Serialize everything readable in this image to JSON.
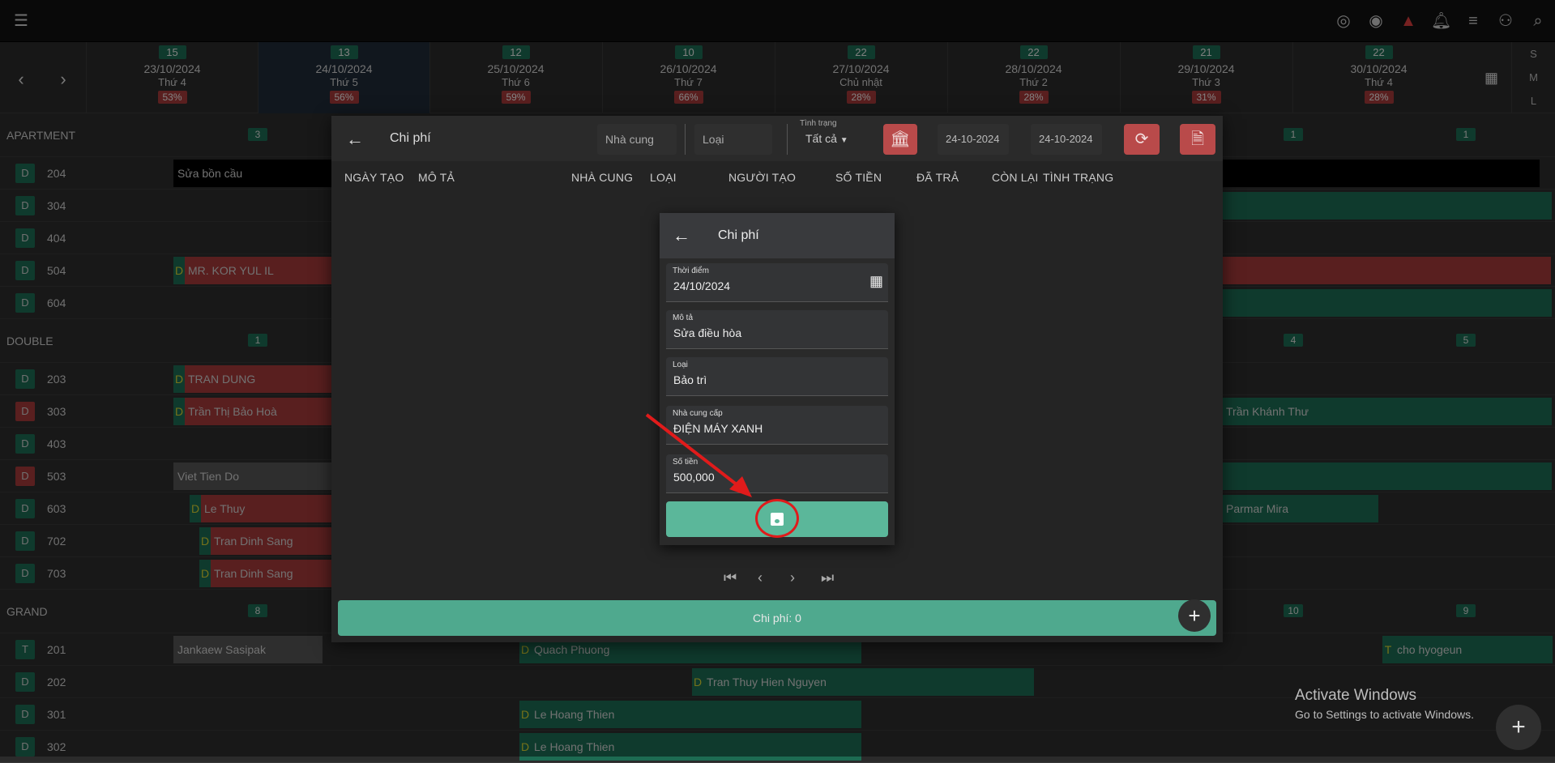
{
  "dates": [
    {
      "count": "15",
      "date": "23/10/2024",
      "weekday": "Thứ 4",
      "pct": "53%"
    },
    {
      "count": "13",
      "date": "24/10/2024",
      "weekday": "Thứ 5",
      "pct": "56%"
    },
    {
      "count": "12",
      "date": "25/10/2024",
      "weekday": "Thứ 6",
      "pct": "59%"
    },
    {
      "count": "10",
      "date": "26/10/2024",
      "weekday": "Thứ 7",
      "pct": "66%"
    },
    {
      "count": "22",
      "date": "27/10/2024",
      "weekday": "Chủ nhật",
      "pct": "28%"
    },
    {
      "count": "22",
      "date": "28/10/2024",
      "weekday": "Thứ 2",
      "pct": "28%"
    },
    {
      "count": "21",
      "date": "29/10/2024",
      "weekday": "Thứ 3",
      "pct": "31%"
    },
    {
      "count": "22",
      "date": "30/10/2024",
      "weekday": "Thứ 4",
      "pct": "28%"
    }
  ],
  "sizes": [
    "S",
    "M",
    "L"
  ],
  "groups": {
    "apartment": {
      "label": "APARTMENT",
      "c1": "3",
      "c2": "1",
      "c3": "1"
    },
    "double": {
      "label": "DOUBLE",
      "c1": "1",
      "c2": "4",
      "c3": "5"
    },
    "grand": {
      "label": "GRAND",
      "c1": "8",
      "c2": "10",
      "c3": "9"
    }
  },
  "rooms": [
    {
      "type": "D",
      "num": "204"
    },
    {
      "type": "D",
      "num": "304"
    },
    {
      "type": "D",
      "num": "404"
    },
    {
      "type": "D",
      "num": "504"
    },
    {
      "type": "D",
      "num": "604"
    },
    {
      "type": "D",
      "num": "203"
    },
    {
      "type": "D",
      "num": "303"
    },
    {
      "type": "D",
      "num": "403"
    },
    {
      "type": "D",
      "num": "503"
    },
    {
      "type": "D",
      "num": "603"
    },
    {
      "type": "D",
      "num": "702"
    },
    {
      "type": "D",
      "num": "703"
    },
    {
      "type": "T",
      "num": "201"
    },
    {
      "type": "D",
      "num": "202"
    },
    {
      "type": "D",
      "num": "301"
    },
    {
      "type": "D",
      "num": "302"
    }
  ],
  "bookings": {
    "b204": "Sửa bồn cầu",
    "b504": "MR. KOR YUL IL",
    "b203": "TRAN DUNG",
    "b303": "Trần Thị Bảo Hoà",
    "b303r": "Trần Khánh Thư",
    "b503": "Viet Tien Do",
    "b603": "Le Thuy",
    "b603r": "Parmar Mira",
    "b702": "Tran Dinh Sang",
    "b703": "Tran Dinh Sang",
    "b201a": "Jankaew Sasipak",
    "b201b": "Quach Phuong",
    "b201c": "cho hyogeun",
    "b202": "Tran Thuy Hien Nguyen",
    "b301": "Le Hoang Thien",
    "b302": "Le Hoang Thien",
    "tag": "D",
    "tagT": "T"
  },
  "panel": {
    "title": "Chi phí",
    "supplier_ph": "Nhà cung",
    "type_ph": "Loại",
    "status_label": "Tình trạng",
    "status_value": "Tất cả",
    "date_from": "24-10-2024",
    "date_to": "24-10-2024",
    "columns": [
      "NGÀY TẠO",
      "MÔ TẢ",
      "NHÀ CUNG",
      "LOẠI",
      "NGƯỜI TẠO",
      "SỐ TIỀN",
      "ĐÃ TRẢ",
      "CÒN LẠI",
      "TÌNH TRẠNG"
    ],
    "footer": "Chi phí: 0"
  },
  "dialog": {
    "title": "Chi phí",
    "time_label": "Thời điểm",
    "time_value": "24/10/2024",
    "desc_label": "Mô tả",
    "desc_value": "Sửa điều hòa",
    "type_label": "Loại",
    "type_value": "Bảo trì",
    "supplier_label": "Nhà cung cấp",
    "supplier_value": "ĐIỆN MÁY XANH",
    "amount_label": "Số tiền",
    "amount_value": "500,000"
  },
  "watermark": {
    "line1": "Activate Windows",
    "line2": "Go to Settings to activate Windows."
  },
  "colors": {
    "accent": "#5bb79a",
    "danger": "#b94a4a",
    "annotation": "#e01b1b"
  }
}
